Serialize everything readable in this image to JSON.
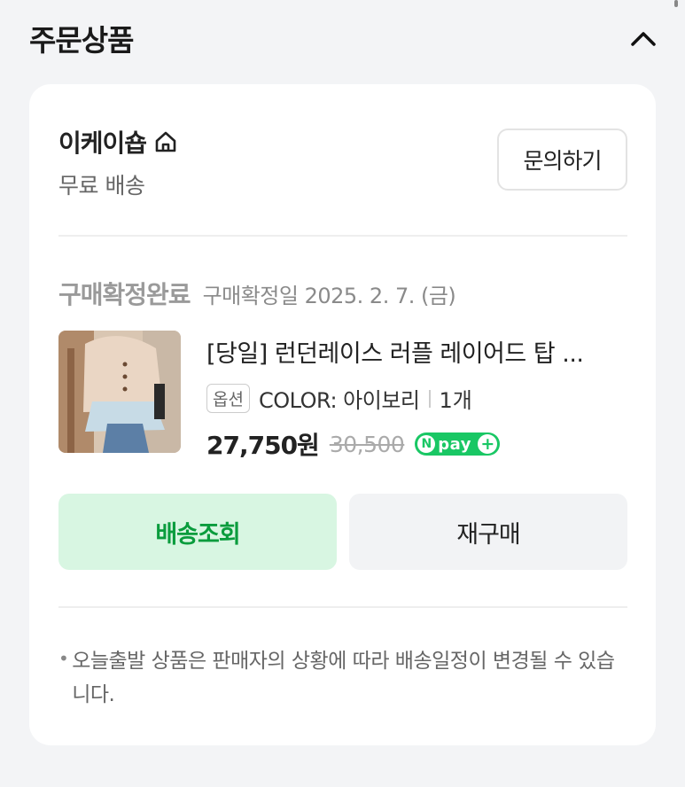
{
  "section": {
    "title": "주문상품",
    "collapse_icon": "chevron-up-icon"
  },
  "store": {
    "name": "이케이숍",
    "home_icon": "home-icon",
    "shipping": "무료 배송",
    "inquiry_label": "문의하기"
  },
  "order": {
    "status": "구매확정완료",
    "confirm_date": "구매확정일 2025. 2. 7. (금)"
  },
  "product": {
    "title": "[당일] 런던레이스 러플 레이어드 탑 ...",
    "option_badge": "옵션",
    "option_text": "COLOR: 아이보리",
    "quantity": "1개",
    "price": "27,750원",
    "original_price": "30,500",
    "npay_label": "pay",
    "npay_n": "N",
    "npay_plus": "+"
  },
  "actions": {
    "track_label": "배송조회",
    "rebuy_label": "재구매"
  },
  "notice": {
    "bullet": "•",
    "text": "오늘출발 상품은 판매자의 상황에 따라 배송일정이 변경될 수 있습니다."
  },
  "colors": {
    "accent_green": "#19c764",
    "track_bg": "#d8f6e2",
    "track_text": "#0a9c3d"
  }
}
